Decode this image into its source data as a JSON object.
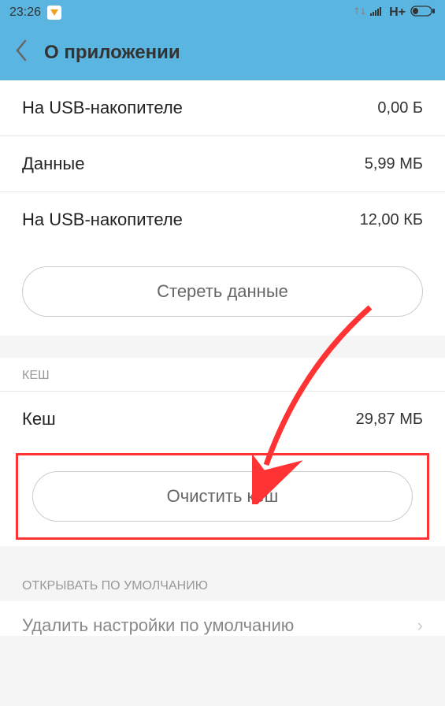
{
  "statusbar": {
    "time": "23:26",
    "network": "H+"
  },
  "header": {
    "title": "О приложении"
  },
  "storage": {
    "rows": [
      {
        "label": "На USB-накопителе",
        "value": "0,00 Б"
      },
      {
        "label": "Данные",
        "value": "5,99 МБ"
      },
      {
        "label": "На USB-накопителе",
        "value": "12,00 КБ"
      }
    ],
    "clear_data_label": "Стереть данные"
  },
  "cache": {
    "section_label": "КЕШ",
    "row": {
      "label": "Кеш",
      "value": "29,87 МБ"
    },
    "clear_cache_label": "Очистить кеш"
  },
  "defaults": {
    "section_label": "ОТКРЫВАТЬ ПО УМОЛЧАНИЮ",
    "reset_label": "Удалить настройки по умолчанию"
  }
}
